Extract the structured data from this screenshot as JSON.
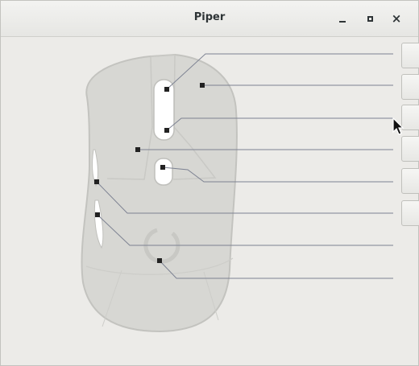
{
  "window": {
    "title": "Piper"
  },
  "titlebar_icons": {
    "minimize": "minimize-icon",
    "maximize": "maximize-icon",
    "close": "close-icon",
    "close_glyph": "×"
  },
  "mouse_buttons": [
    {
      "name": "left-button-hotspot"
    },
    {
      "name": "right-button-hotspot"
    },
    {
      "name": "middle-button-hotspot"
    },
    {
      "name": "left-body-hotspot"
    },
    {
      "name": "dpi-button-hotspot"
    },
    {
      "name": "side-forward-hotspot"
    },
    {
      "name": "side-back-hotspot"
    },
    {
      "name": "bottom-sensor-hotspot"
    }
  ],
  "side_buttons_count": 6,
  "colors": {
    "leader_line": "#7d8292",
    "hotspot": "#222222",
    "mouse_body": "#d7d7d3",
    "mouse_outline": "#c3c3bf"
  }
}
